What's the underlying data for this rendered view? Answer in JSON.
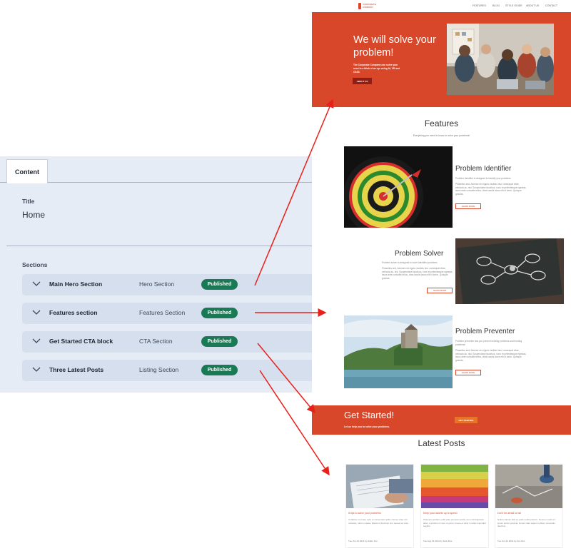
{
  "cms": {
    "tab_label": "Content",
    "title_label": "Title",
    "title_value": "Home",
    "sections_label": "Sections",
    "sections": [
      {
        "name": "Main Hero Section",
        "type": "Hero Section",
        "status": "Published"
      },
      {
        "name": "Features section",
        "type": "Features Section",
        "status": "Published"
      },
      {
        "name": "Get Started CTA block",
        "type": "CTA Section",
        "status": "Published"
      },
      {
        "name": "Three Latest Posts",
        "type": "Listing Section",
        "status": "Published"
      }
    ],
    "status_color": "#1a7a55"
  },
  "site": {
    "logo_text": "CORPORATE COMPANY",
    "nav": [
      "FEATURES",
      "BLOG",
      "STYLE GUIDE",
      "ABOUT US",
      "CONTACT"
    ],
    "hero": {
      "title": "We will solve your problem!",
      "subtitle": "The Corporate Company can solve your need in a blink of an eye using AI, VR and CSS3.",
      "button": "ABOUT US"
    },
    "features": {
      "title": "Features",
      "subtitle": "Everything you need to know to solve your problems!",
      "items": [
        {
          "title": "Problem Identifier",
          "tagline": "Problem Identifier is designed to identify your problems",
          "body": "Phasellus sed, Aenean nec ligula, facilisis nisl, consequat vitae, vehicula ac, nisl. Suspendisse faucibus, nunc et pellentesque egestas, lacus ante convallis tellus, vitae iaculis lacus elit id tortor. Quisque gravida.",
          "button": "LEARN MORE"
        },
        {
          "title": "Problem Solver",
          "tagline": "Problem solver is designed to solve identified problems",
          "body": "Phasellus sed, Aenean nec ligula, facilisis nisl, consequat vitae, vehicula ac, nisl. Suspendisse faucibus, nunc et pellentesque egestas, lacus ante convallis tellus, vitae iaculis lacus elit id tortor. Quisque gravida.",
          "button": "LEARN MORE"
        },
        {
          "title": "Problem Preventer",
          "tagline": "Problem preventer lets you prevent existing problems and forming problems!",
          "body": "Phasellus sed, Aenean nec ligula, facilisis nisl, consequat vitae, vehicula ac, nisl. Suspendisse faucibus, nunc et pellentesque egestas, lacus ante convallis tellus, vitae iaculis lacus elit id tortor. Quisque gravida.",
          "button": "LEARN MORE"
        }
      ]
    },
    "cta": {
      "title": "Get Started!",
      "subtitle": "Let us help you to solve your problems.",
      "button": "GET STARTED"
    },
    "posts": {
      "title": "Latest Posts",
      "items": [
        {
          "title": "5 tips to solve your problems",
          "body": "Curabitur ut ornare velit, et consectetur tellus. Donec vitae nisi molestie, rutrum massa. Mauris id tincidunt nisi, laoreet ac ante.",
          "meta": "Tue Jun 24 2014 by Adam Fox"
        },
        {
          "title": "Keep your assets up to speed",
          "body": "Praesent porttitor, nulla vitae posuere iaculis, arcu nisl dignissim dolor, a pretium mi sem ut purus. Fusce et dolor in tellus imperdiet sagittis.",
          "meta": "Tue Aug 19 2014 by Jane Doe"
        },
        {
          "title": "Don't be afraid to fail",
          "body": "Nullam dictum felis eu pede mollis pretium. Donec in velit vel ipsum auctor pulvinar. Donec vitae sapien ut libero venenatis faucibus.",
          "meta": "Tue Jun 24 2014 by Fox Rox"
        }
      ]
    },
    "accent_color": "#d9472a"
  },
  "arrow_color": "#e8201a"
}
